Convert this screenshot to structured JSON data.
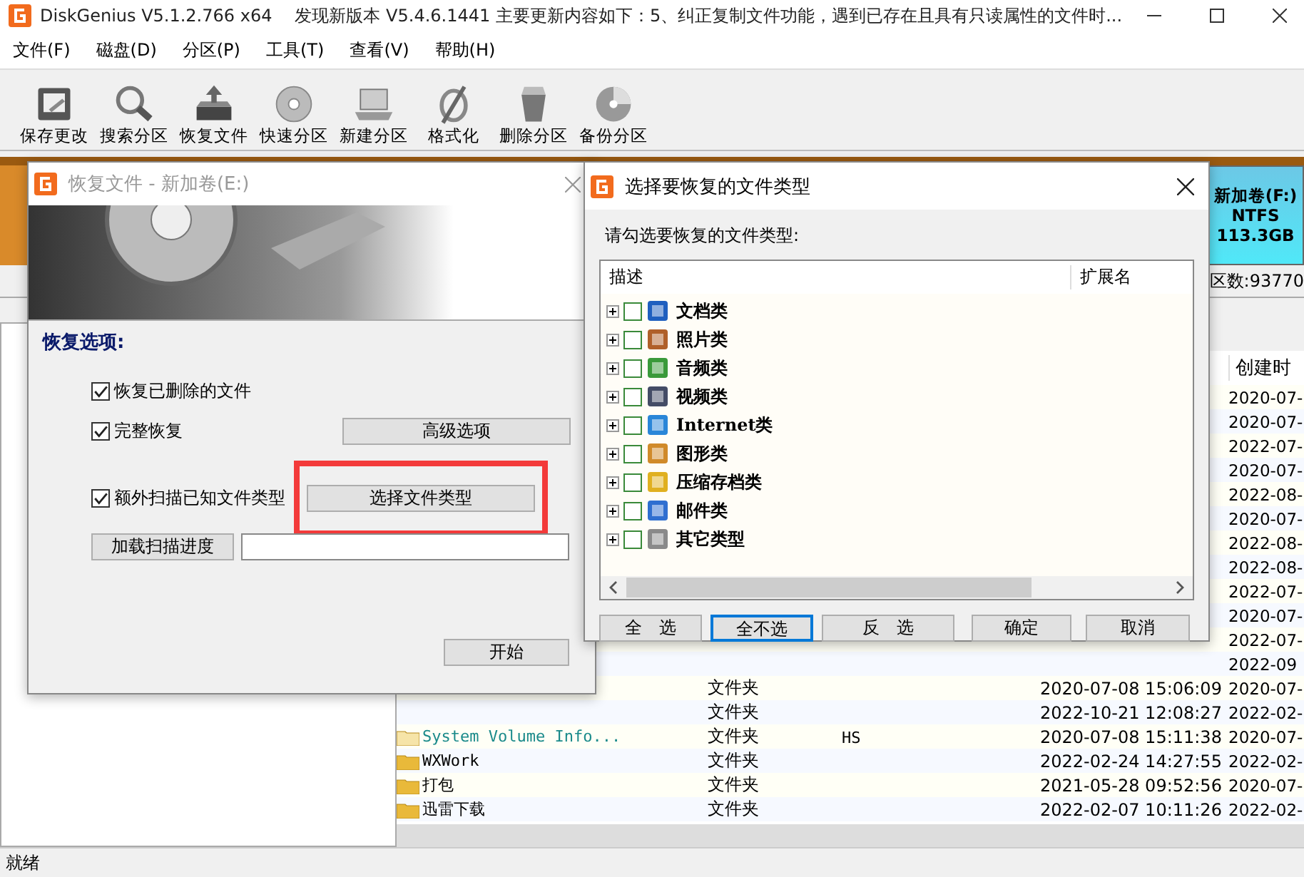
{
  "window": {
    "title": "DiskGenius V5.1.2.766 x64",
    "notice": "发现新版本 V5.4.6.1441 主要更新内容如下：5、纠正复制文件功能，遇到已存在且具有只读属性的文件时..."
  },
  "menu": [
    "文件(F)",
    "磁盘(D)",
    "分区(P)",
    "工具(T)",
    "查看(V)",
    "帮助(H)"
  ],
  "toolbar": [
    {
      "label": "保存更改",
      "kind": "save"
    },
    {
      "label": "搜索分区",
      "kind": "search"
    },
    {
      "label": "恢复文件",
      "kind": "restore"
    },
    {
      "label": "快速分区",
      "kind": "disc"
    },
    {
      "label": "新建分区",
      "kind": "laptop"
    },
    {
      "label": "格式化",
      "kind": "format"
    },
    {
      "label": "删除分区",
      "kind": "trash"
    },
    {
      "label": "备份分区",
      "kind": "backup"
    }
  ],
  "disk_map": {
    "partition": {
      "name": "新加卷(F:)",
      "filesystem": "NTFS",
      "size": "113.3GB"
    },
    "info": "区数:93770"
  },
  "file_list": {
    "created_header": "创建时",
    "rows": [
      {
        "created": "2020-07-"
      },
      {
        "created": "2020-07-"
      },
      {
        "created": "2022-07-"
      },
      {
        "created": "2020-07-"
      },
      {
        "created": "2022-08-"
      },
      {
        "created": "2020-07-"
      },
      {
        "created": "2022-08-"
      },
      {
        "created": "2022-08-"
      },
      {
        "created": "2022-07-"
      },
      {
        "created": "2020-07-"
      },
      {
        "created": "2022-07-"
      },
      {
        "created": "2022-09"
      },
      {
        "type": "文件夹",
        "modified": "2020-07-08 15:06:09",
        "created": "2020-07-"
      },
      {
        "type": "文件夹",
        "modified": "2022-10-21 12:08:27",
        "created": "2022-02-"
      },
      {
        "name": "System Volume Info...",
        "system": true,
        "type": "文件夹",
        "attributes": "HS",
        "modified": "2020-07-08 15:11:38",
        "created": "2020-07-"
      },
      {
        "name": "WXWork",
        "system": false,
        "type": "文件夹",
        "modified": "2022-02-24 14:27:55",
        "created": "2022-02-"
      },
      {
        "name": "打包",
        "system": false,
        "type": "文件夹",
        "modified": "2021-05-28 09:52:56",
        "created": "2020-07-"
      },
      {
        "name": "迅雷下载",
        "system": false,
        "type": "文件夹",
        "modified": "2022-02-07 10:11:26",
        "created": "2022-02-"
      }
    ]
  },
  "status_bar": "就绪",
  "recover_dialog": {
    "title": "恢复文件 - 新加卷(E:)",
    "section_title": "恢复选项:",
    "options": [
      {
        "label": "恢复已删除的文件",
        "checked": true
      },
      {
        "label": "完整恢复",
        "checked": true
      },
      {
        "label": "额外扫描已知文件类型",
        "checked": true
      }
    ],
    "advanced_button": "高级选项",
    "file_type_button": {
      "label": "选择文件类型",
      "highlighted": true
    },
    "load_button": "加载扫描进度",
    "start_button": "开始"
  },
  "file_type_dialog": {
    "title": "选择要恢复的文件类型",
    "prompt": "请勾选要恢复的文件类型:",
    "columns": [
      "描述",
      "扩展名"
    ],
    "types": [
      {
        "label": "文档类",
        "kind": "document",
        "checked": false
      },
      {
        "label": "照片类",
        "kind": "photo",
        "checked": false
      },
      {
        "label": "音频类",
        "kind": "audio",
        "checked": false
      },
      {
        "label": "视频类",
        "kind": "video",
        "checked": false
      },
      {
        "label": "Internet类",
        "kind": "internet",
        "checked": false
      },
      {
        "label": "图形类",
        "kind": "graphics",
        "checked": false
      },
      {
        "label": "压缩存档类",
        "kind": "archive",
        "checked": false
      },
      {
        "label": "邮件类",
        "kind": "mail",
        "checked": false
      },
      {
        "label": "其它类型",
        "kind": "other",
        "checked": false
      }
    ],
    "buttons": [
      {
        "label": "全　选",
        "focused": false
      },
      {
        "label": "全不选",
        "focused": true
      },
      {
        "label": "反　选",
        "focused": false
      },
      {
        "label": "确定",
        "focused": false
      },
      {
        "label": "取消",
        "focused": false
      }
    ]
  }
}
